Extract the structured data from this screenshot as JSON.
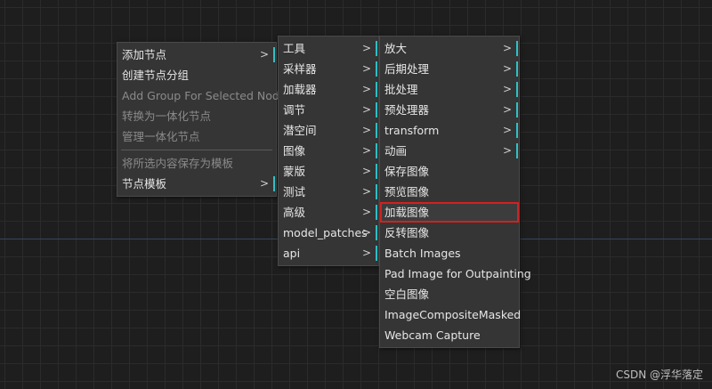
{
  "menu1": {
    "items": [
      {
        "label": "添加节点",
        "submenu": true,
        "disabled": false
      },
      {
        "label": "创建节点分组",
        "submenu": false,
        "disabled": false
      },
      {
        "label": "Add Group For Selected Nodes",
        "submenu": false,
        "disabled": true
      },
      {
        "label": "转换为一体化节点",
        "submenu": false,
        "disabled": true
      },
      {
        "label": "管理一体化节点",
        "submenu": false,
        "disabled": true
      },
      {
        "separator": true
      },
      {
        "label": "将所选内容保存为模板",
        "submenu": false,
        "disabled": true
      },
      {
        "label": "节点模板",
        "submenu": true,
        "disabled": false
      }
    ]
  },
  "menu2": {
    "items": [
      {
        "label": "工具",
        "submenu": true
      },
      {
        "label": "采样器",
        "submenu": true
      },
      {
        "label": "加载器",
        "submenu": true
      },
      {
        "label": "调节",
        "submenu": true
      },
      {
        "label": "潜空间",
        "submenu": true
      },
      {
        "label": "图像",
        "submenu": true
      },
      {
        "label": "蒙版",
        "submenu": true
      },
      {
        "label": "测试",
        "submenu": true
      },
      {
        "label": "高级",
        "submenu": true
      },
      {
        "label": "model_patches",
        "submenu": true
      },
      {
        "label": "api",
        "submenu": true
      }
    ]
  },
  "menu3": {
    "items": [
      {
        "label": "放大",
        "submenu": true
      },
      {
        "label": "后期处理",
        "submenu": true
      },
      {
        "label": "批处理",
        "submenu": true
      },
      {
        "label": "预处理器",
        "submenu": true
      },
      {
        "label": "transform",
        "submenu": true
      },
      {
        "label": "动画",
        "submenu": true
      },
      {
        "label": "保存图像",
        "submenu": false
      },
      {
        "label": "预览图像",
        "submenu": false
      },
      {
        "label": "加载图像",
        "submenu": false,
        "highlight": true
      },
      {
        "label": "反转图像",
        "submenu": false
      },
      {
        "label": "Batch Images",
        "submenu": false
      },
      {
        "label": "Pad Image for Outpainting",
        "submenu": false
      },
      {
        "label": "空白图像",
        "submenu": false
      },
      {
        "label": "ImageCompositeMasked",
        "submenu": false
      },
      {
        "label": "Webcam Capture",
        "submenu": false
      }
    ]
  },
  "chevron_glyph": ">",
  "watermark": "CSDN @浮华落定",
  "colors": {
    "background": "#1e1e1e",
    "grid": "#2b2b2b",
    "menu_bg": "#353535",
    "text": "#e6e6e6",
    "disabled_text": "#8a8a8a",
    "submenu_marker": "#2fc2c7",
    "highlight_border": "#d42020"
  }
}
